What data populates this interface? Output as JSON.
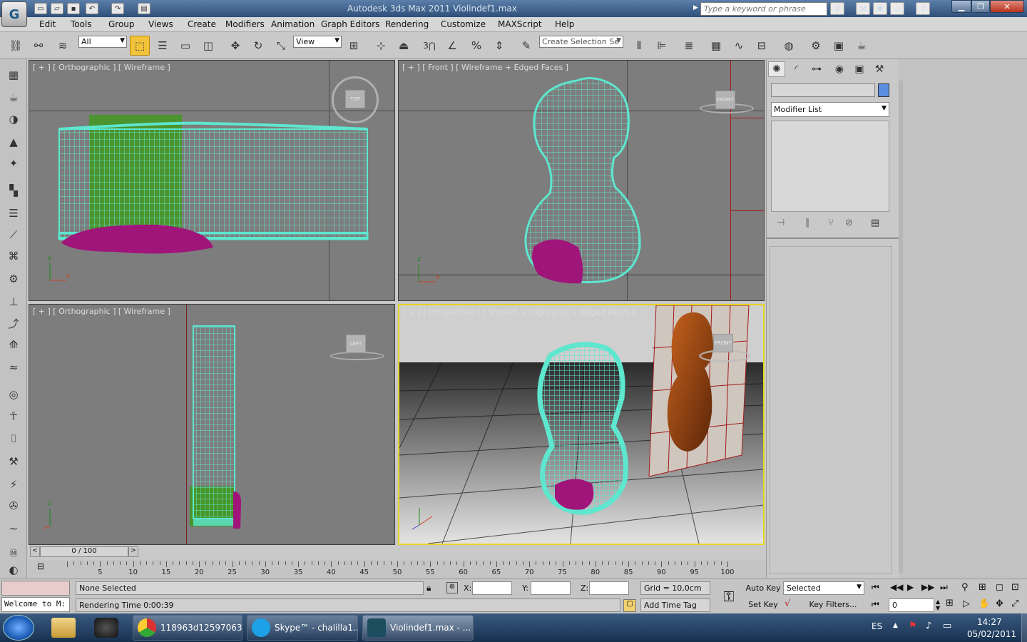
{
  "window": {
    "title": "Autodesk 3ds Max 2011     Violindef1.max",
    "search_placeholder": "Type a keyword or phrase"
  },
  "menu": [
    "Edit",
    "Tools",
    "Group",
    "Views",
    "Create",
    "Modifiers",
    "Animation",
    "Graph Editors",
    "Rendering",
    "Customize",
    "MAXScript",
    "Help"
  ],
  "toolbar": {
    "filter_value": "All",
    "refcoord_value": "View",
    "selection_set_placeholder": "Create Selection Se",
    "snap_label": "3"
  },
  "viewports": [
    {
      "label": "[ + ] [ Orthographic ] [ Wireframe ]",
      "cube": "TOP"
    },
    {
      "label": "[ + ] [ Front ] [ Wireframe + Edged Faces ]",
      "cube": "FRONT"
    },
    {
      "label": "[ + ] [ Orthographic ] [ Wireframe ]",
      "cube": "LEFT"
    },
    {
      "label": "[ + ] [ Perspective ] [ Smooth + Highlights + Edged Faces ]",
      "cube": "FRONT"
    }
  ],
  "command_panel": {
    "name_value": "",
    "modifier_list": "Modifier List"
  },
  "timeline": {
    "frame_readout": "0 / 100",
    "ticks": [
      "5",
      "10",
      "15",
      "20",
      "25",
      "30",
      "35",
      "40",
      "45",
      "50",
      "55",
      "60",
      "65",
      "70",
      "75",
      "80",
      "85",
      "90",
      "95",
      "100"
    ]
  },
  "status": {
    "maxscript_listener": "Welcome to M:",
    "selection_status": "None Selected",
    "render_time": "Rendering Time  0:00:39",
    "x_label": "X:",
    "y_label": "Y:",
    "z_label": "Z:",
    "grid": "Grid = 10,0cm",
    "add_time_tag": "Add Time Tag",
    "auto_key": "Auto Key",
    "set_key": "Set Key",
    "key_mode": "Selected",
    "key_filters": "Key Filters...",
    "current_frame": "0"
  },
  "taskbar": {
    "items": [
      {
        "label": "118963d12597063..."
      },
      {
        "label": "Skype™ - chalilla1..."
      },
      {
        "label": "Violindef1.max - ..."
      }
    ],
    "lang": "ES",
    "time": "14:27",
    "date": "05/02/2011"
  },
  "colors": {
    "wire": "#5ee6cf",
    "magenta": "#a0157a",
    "green": "#3e9a1a",
    "active_border": "#e5d520"
  }
}
